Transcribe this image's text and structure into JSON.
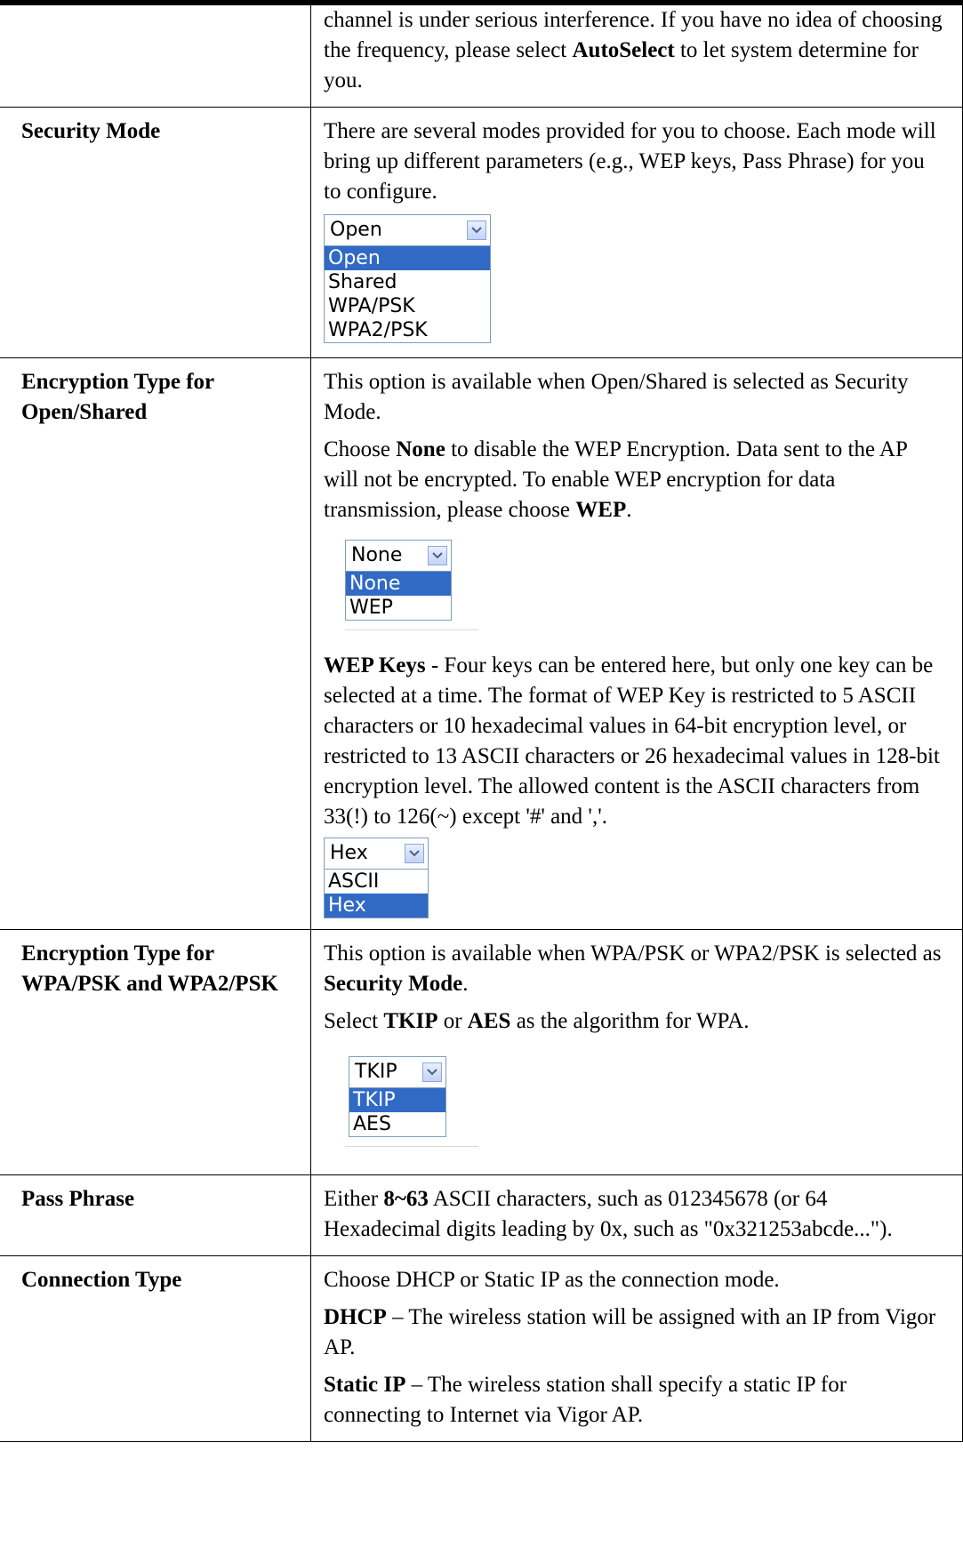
{
  "rows": [
    {
      "label": "",
      "paragraphs": [
        [
          {
            "t": "channel is under serious interference. If you have no idea of choosing the frequency, please select ",
            "b": false
          },
          {
            "t": "AutoSelect",
            "b": true
          },
          {
            "t": " to let system determine for you.",
            "b": false
          }
        ]
      ]
    },
    {
      "label": "Security Mode",
      "paragraphs": [
        [
          {
            "t": "There are several modes provided for you to choose. Each mode will bring up different parameters (e.g., WEP keys, Pass Phrase) for you to configure.",
            "b": false
          }
        ]
      ],
      "dropdown": {
        "selected": "Open",
        "options": [
          "Open",
          "Shared",
          "WPA/PSK",
          "WPA2/PSK"
        ],
        "highlight": "Open"
      }
    },
    {
      "label": "Encryption Type for Open/Shared",
      "paragraphs": [
        [
          {
            "t": "This option is available when Open/Shared is selected as Security Mode.",
            "b": false
          }
        ],
        [
          {
            "t": "Choose ",
            "b": false
          },
          {
            "t": "None",
            "b": true
          },
          {
            "t": " to disable the WEP Encryption. Data sent to the AP will not be encrypted. To enable WEP encryption for data transmission, please choose ",
            "b": false
          },
          {
            "t": "WEP",
            "b": true
          },
          {
            "t": ".",
            "b": false
          }
        ]
      ],
      "dropdown": {
        "selected": "None",
        "options": [
          "None",
          "WEP"
        ],
        "highlight": "None"
      },
      "paragraphs_after": [
        [
          {
            "t": "WEP Keys",
            "b": true
          },
          {
            "t": " - Four keys can be entered here, but only one key can be selected at a time. The format of WEP Key is restricted to 5 ASCII characters or 10 hexadecimal values in 64-bit encryption level, or restricted to 13 ASCII characters or 26 hexadecimal values in 128-bit encryption level. The allowed content is the ASCII characters from 33(!) to 126(~) except '#' and ','.",
            "b": false
          }
        ]
      ],
      "dropdown2": {
        "selected": "Hex",
        "options": [
          "ASCII",
          "Hex"
        ],
        "highlight": "Hex"
      }
    },
    {
      "label": "Encryption Type for WPA/PSK and WPA2/PSK",
      "paragraphs": [
        [
          {
            "t": "This option is available when WPA/PSK or WPA2/PSK is selected as ",
            "b": false
          },
          {
            "t": "Security Mode",
            "b": true
          },
          {
            "t": ".",
            "b": false
          }
        ],
        [
          {
            "t": "Select ",
            "b": false
          },
          {
            "t": "TKIP",
            "b": true
          },
          {
            "t": " or ",
            "b": false
          },
          {
            "t": "AES",
            "b": true
          },
          {
            "t": " as the algorithm for WPA.",
            "b": false
          }
        ]
      ],
      "dropdown": {
        "selected": "TKIP",
        "options": [
          "TKIP",
          "AES"
        ],
        "highlight": "TKIP"
      }
    },
    {
      "label": "Pass Phrase",
      "paragraphs": [
        [
          {
            "t": "Either ",
            "b": false
          },
          {
            "t": "8~63",
            "b": true
          },
          {
            "t": " ASCII characters, such as 012345678 (or 64 Hexadecimal digits leading by 0x, such as \"0x321253abcde...\").",
            "b": false
          }
        ]
      ]
    },
    {
      "label": "Connection Type",
      "paragraphs": [
        [
          {
            "t": "Choose DHCP or Static IP as the connection mode.",
            "b": false
          }
        ],
        [
          {
            "t": "DHCP",
            "b": true
          },
          {
            "t": " – The wireless station will be assigned with an IP from Vigor AP.",
            "b": false
          }
        ],
        [
          {
            "t": "Static IP",
            "b": true
          },
          {
            "t": " – The wireless station shall specify a static IP for connecting to Internet via Vigor AP.",
            "b": false
          }
        ]
      ]
    }
  ]
}
